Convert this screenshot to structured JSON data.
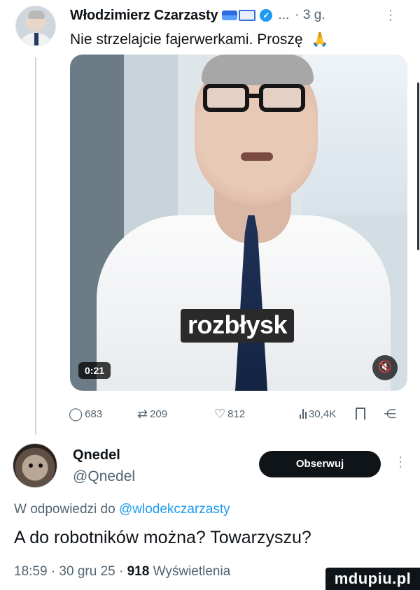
{
  "tweet": {
    "author_name": "Włodzimierz Czarzasty",
    "ellipsis": "...",
    "time": "· 3 g.",
    "more": "⋮",
    "text": "Nie strzelajcie fajerwerkami. Proszę",
    "emoji_pray": "🙏",
    "media": {
      "caption": "rozbłysk",
      "duration": "0:21",
      "mute_icon": "🔇"
    },
    "actions": {
      "replies": "683",
      "retweets": "209",
      "likes": "812",
      "views": "30,4K"
    }
  },
  "reply": {
    "author_name": "Qnedel",
    "handle": "@Qnedel",
    "follow_label": "Obserwuj",
    "more": "⋮",
    "replying_prefix": "W odpowiedzi do",
    "replying_mention": "@wlodekczarzasty",
    "text": "A do robotników można? Towarzyszu?",
    "time": "18:59 · 30 gru 25 ·",
    "views_count": "918",
    "views_label": "Wyświetlenia"
  },
  "watermark": "mdupiu.pl",
  "colors": {
    "accent": "#1d9bf0",
    "text": "#0f1419",
    "muted": "#536471",
    "button": "#0f1419"
  }
}
